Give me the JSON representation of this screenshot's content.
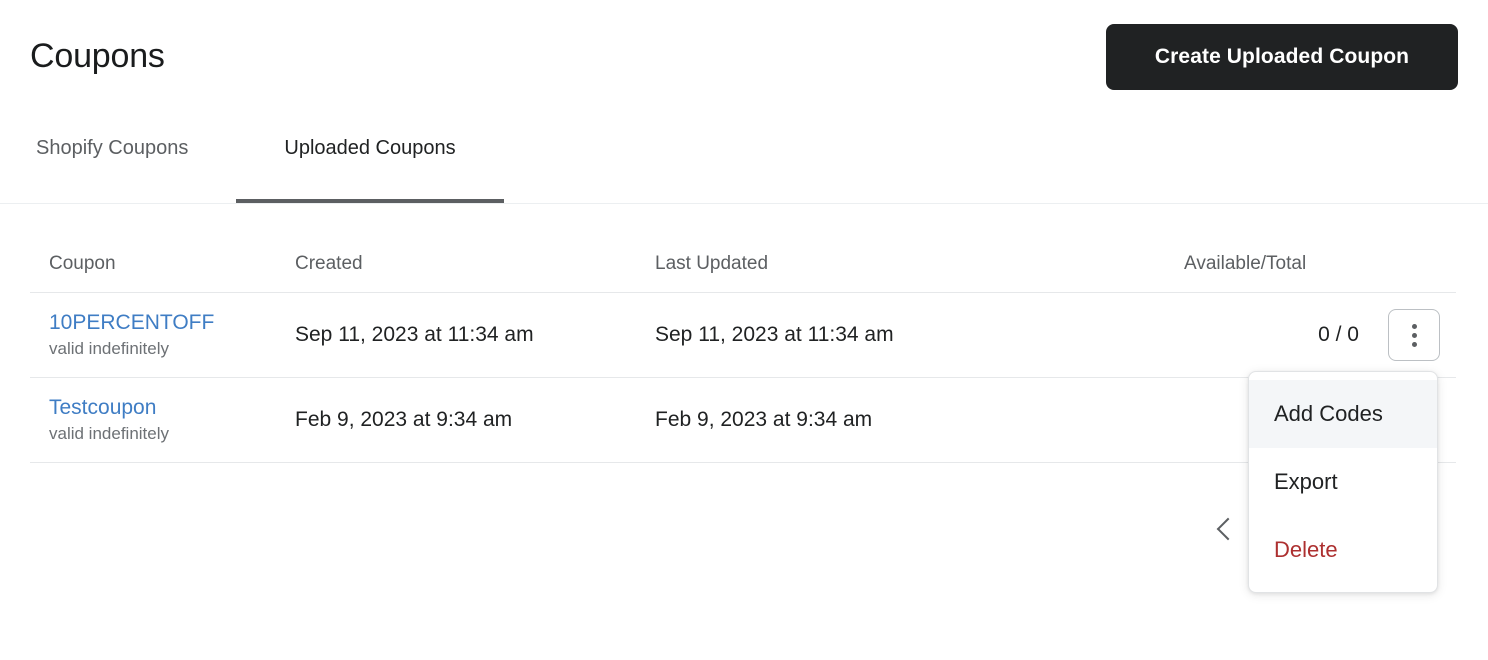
{
  "header": {
    "title": "Coupons",
    "primary_button": "Create Uploaded Coupon"
  },
  "tabs": [
    {
      "label": "Shopify Coupons",
      "active": false
    },
    {
      "label": "Uploaded Coupons",
      "active": true
    }
  ],
  "table": {
    "columns": [
      "Coupon",
      "Created",
      "Last Updated",
      "Available/Total"
    ],
    "rows": [
      {
        "coupon": "10PERCENTOFF",
        "validity": "valid indefinitely",
        "created": "Sep 11, 2023 at 11:34 am",
        "last_updated": "Sep 11, 2023 at 11:34 am",
        "available_total": "0 / 0"
      },
      {
        "coupon": "Testcoupon",
        "validity": "valid indefinitely",
        "created": "Feb 9, 2023 at 9:34 am",
        "last_updated": "Feb 9, 2023 at 9:34 am",
        "available_total": ""
      }
    ]
  },
  "pagination": {
    "previous_label": "Previous"
  },
  "dropdown": {
    "items": [
      {
        "label": "Add Codes",
        "highlighted": true,
        "destructive": false
      },
      {
        "label": "Export",
        "highlighted": false,
        "destructive": false
      },
      {
        "label": "Delete",
        "highlighted": false,
        "destructive": true
      }
    ]
  },
  "icons": {
    "kebab": "kebab-vertical-icon",
    "chevron_left": "chevron-left-icon"
  },
  "colors": {
    "primary_button_bg": "#202223",
    "link": "#3f7dc4",
    "destructive": "#ad3030",
    "tab_underline": "#5c5f62",
    "border": "#e6e8ea"
  }
}
